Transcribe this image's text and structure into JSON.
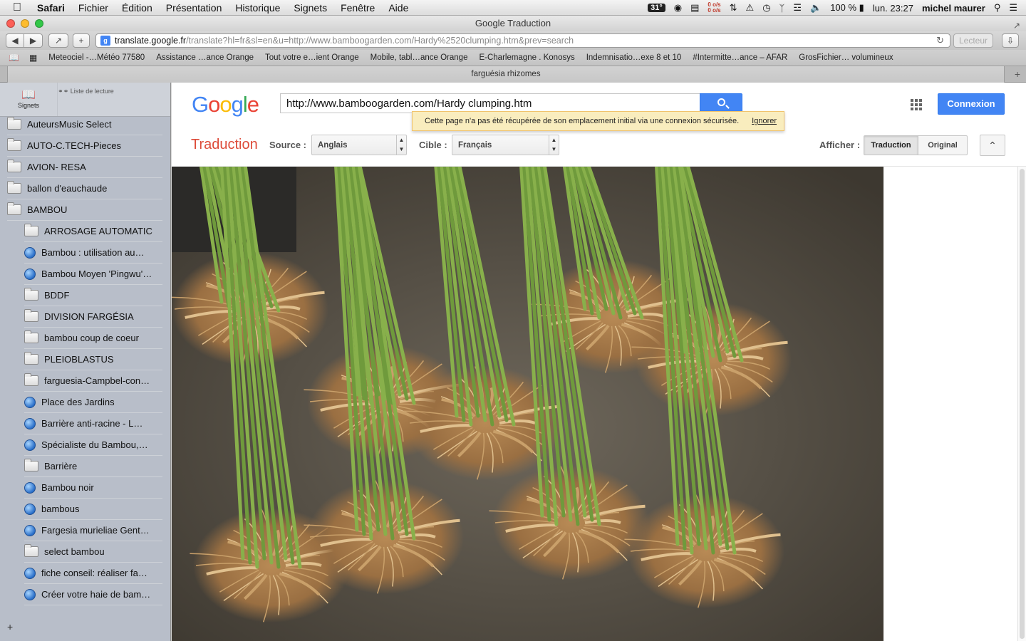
{
  "menubar": {
    "app": "Safari",
    "items": [
      "Fichier",
      "Édition",
      "Présentation",
      "Historique",
      "Signets",
      "Fenêtre",
      "Aide"
    ],
    "temperature": "31°",
    "net_up": "0 o/s",
    "net_down": "0 o/s",
    "battery": "100 %",
    "clock": "lun. 23:27",
    "user": "michel maurer"
  },
  "window": {
    "title": "Google Traduction"
  },
  "toolbar": {
    "url_host": "translate.google.fr",
    "url_path": "/translate?hl=fr&sl=en&u=http://www.bamboogarden.com/Hardy%2520clumping.htm&prev=search",
    "reader_label": "Lecteur"
  },
  "bookmarks": [
    "Meteociel -…Météo 77580",
    "Assistance …ance Orange",
    "Tout votre e…ient Orange",
    "Mobile, tabl…ance Orange",
    "E-Charlemagne . Konosys",
    "Indemnisatio…exe 8 et 10",
    "#Intermitte…ance – AFAR",
    "GrosFichier… volumineux"
  ],
  "tab": {
    "title": "farguésia rhizomes"
  },
  "sidebar": {
    "tab_bookmarks": "Signets",
    "tab_reading": "Liste de lecture",
    "items": [
      {
        "label": "AutеursMusic Select",
        "type": "folder",
        "level": 0
      },
      {
        "label": "AUTO-C.TECH-Pieces",
        "type": "folder",
        "level": 0
      },
      {
        "label": "AVION- RESA",
        "type": "folder",
        "level": 0
      },
      {
        "label": "ballon d'eauchaude",
        "type": "folder",
        "level": 0
      },
      {
        "label": "BAMBOU",
        "type": "folder",
        "level": 0
      },
      {
        "label": "ARROSAGE AUTOMATIC",
        "type": "folder",
        "level": 1
      },
      {
        "label": "Bambou : utilisation au…",
        "type": "link",
        "level": 1
      },
      {
        "label": "Bambou Moyen 'Pingwu'…",
        "type": "link",
        "level": 1
      },
      {
        "label": "BDDF",
        "type": "folder",
        "level": 1
      },
      {
        "label": "DIVISION FARGÉSIA",
        "type": "folder",
        "level": 1
      },
      {
        "label": "bambou coup de coeur",
        "type": "folder",
        "level": 1
      },
      {
        "label": "PLEIOBLASTUS",
        "type": "folder",
        "level": 1
      },
      {
        "label": "farguesia-Campbel-con…",
        "type": "folder",
        "level": 1
      },
      {
        "label": "Place des Jardins",
        "type": "link",
        "level": 1
      },
      {
        "label": "Barrière anti-racine - L…",
        "type": "link",
        "level": 1
      },
      {
        "label": "Spécialiste du Bambou,…",
        "type": "link",
        "level": 1
      },
      {
        "label": "Barrière",
        "type": "folder",
        "level": 1
      },
      {
        "label": "Bambou noir",
        "type": "link",
        "level": 1
      },
      {
        "label": "bambous",
        "type": "link",
        "level": 1
      },
      {
        "label": "Fargesia murieliae Gent…",
        "type": "link",
        "level": 1
      },
      {
        "label": "select bambou",
        "type": "folder",
        "level": 1
      },
      {
        "label": "fiche conseil: réaliser fa…",
        "type": "link",
        "level": 1
      },
      {
        "label": "Créer votre haie de bam…",
        "type": "link",
        "level": 1
      }
    ]
  },
  "google": {
    "logo": [
      "G",
      "o",
      "o",
      "g",
      "l",
      "e"
    ],
    "search_value": "http://www.bamboogarden.com/Hardy clumping.htm",
    "connexion": "Connexion",
    "notice": "Cette page n'a pas été récupérée de son emplacement initial via une connexion sécurisée.",
    "notice_dismiss": "Ignorer",
    "translate_title": "Traduction",
    "source_label": "Source :",
    "source_value": "Anglais",
    "target_label": "Cible :",
    "target_value": "Français",
    "show_label": "Afficher :",
    "view_translation": "Traduction",
    "view_original": "Original"
  }
}
